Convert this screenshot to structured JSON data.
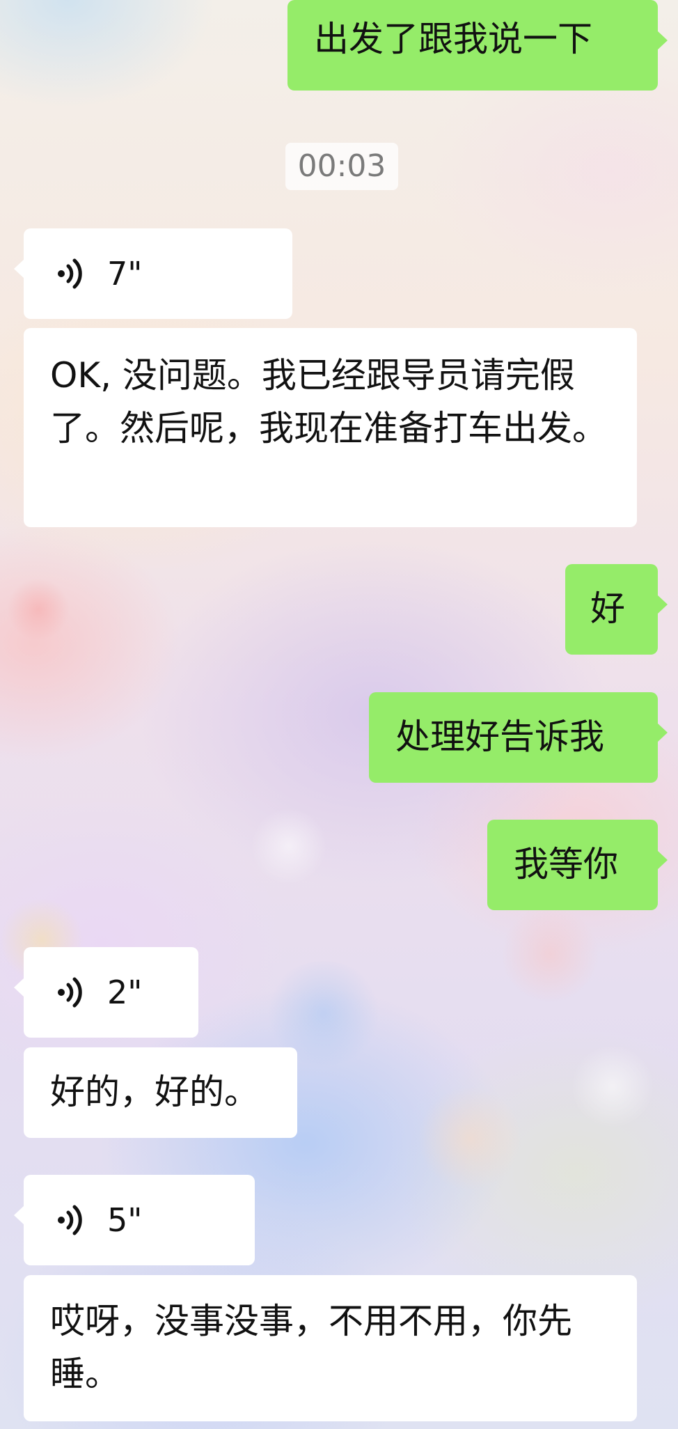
{
  "messages": [
    {
      "side": "right",
      "type": "text",
      "text": "出发了跟我说一下"
    },
    {
      "type": "time",
      "text": "00:03"
    },
    {
      "side": "left",
      "type": "voice",
      "duration": "7\""
    },
    {
      "side": "left",
      "type": "text",
      "text": "OK, 没问题。我已经跟导员请完假了。然后呢，我现在准备打车出发。"
    },
    {
      "side": "right",
      "type": "text",
      "text": "好"
    },
    {
      "side": "right",
      "type": "text",
      "text": "处理好告诉我"
    },
    {
      "side": "right",
      "type": "text",
      "text": "我等你"
    },
    {
      "side": "left",
      "type": "voice",
      "duration": "2\""
    },
    {
      "side": "left",
      "type": "text",
      "text": "好的，好的。"
    },
    {
      "side": "left",
      "type": "voice",
      "duration": "5\""
    },
    {
      "side": "left",
      "type": "text",
      "text": "哎呀，没事没事，不用不用，你先睡。"
    }
  ],
  "colors": {
    "outgoing_bubble": "#95ec69",
    "incoming_bubble": "#ffffff",
    "time_text": "#7a7a7a"
  },
  "icons": {
    "voice": "voice-wave-icon"
  }
}
